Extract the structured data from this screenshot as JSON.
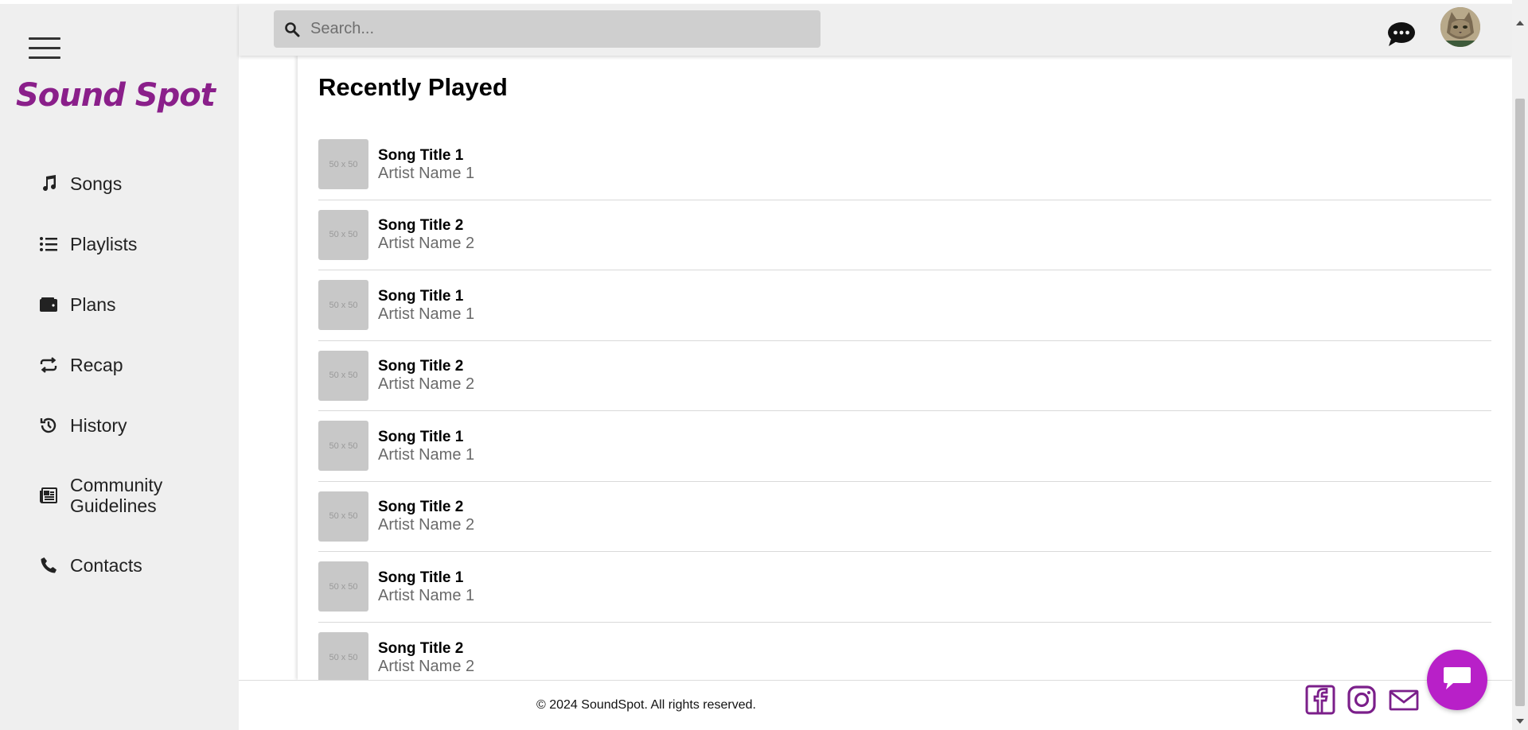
{
  "app": {
    "logo_text": "Sound Spot",
    "accent_color": "#8a1f8a",
    "fab_color": "#b820c8"
  },
  "sidebar": {
    "items": [
      {
        "label": "Songs",
        "icon": "music-note-icon"
      },
      {
        "label": "Playlists",
        "icon": "list-icon"
      },
      {
        "label": "Plans",
        "icon": "wallet-icon"
      },
      {
        "label": "Recap",
        "icon": "repeat-icon"
      },
      {
        "label": "History",
        "icon": "history-icon"
      },
      {
        "label": "Community Guidelines",
        "icon": "newspaper-icon"
      },
      {
        "label": "Contacts",
        "icon": "phone-icon"
      }
    ]
  },
  "search": {
    "placeholder": "Search..."
  },
  "main": {
    "heading": "Recently Played",
    "thumb_placeholder": "50 x 50",
    "songs": [
      {
        "title": "Song Title 1",
        "artist": "Artist Name 1"
      },
      {
        "title": "Song Title 2",
        "artist": "Artist Name 2"
      },
      {
        "title": "Song Title 1",
        "artist": "Artist Name 1"
      },
      {
        "title": "Song Title 2",
        "artist": "Artist Name 2"
      },
      {
        "title": "Song Title 1",
        "artist": "Artist Name 1"
      },
      {
        "title": "Song Title 2",
        "artist": "Artist Name 2"
      },
      {
        "title": "Song Title 1",
        "artist": "Artist Name 1"
      },
      {
        "title": "Song Title 2",
        "artist": "Artist Name 2"
      }
    ]
  },
  "footer": {
    "copyright": "© 2024 SoundSpot. All rights reserved.",
    "social": [
      "facebook-icon",
      "instagram-icon",
      "mail-icon"
    ]
  }
}
